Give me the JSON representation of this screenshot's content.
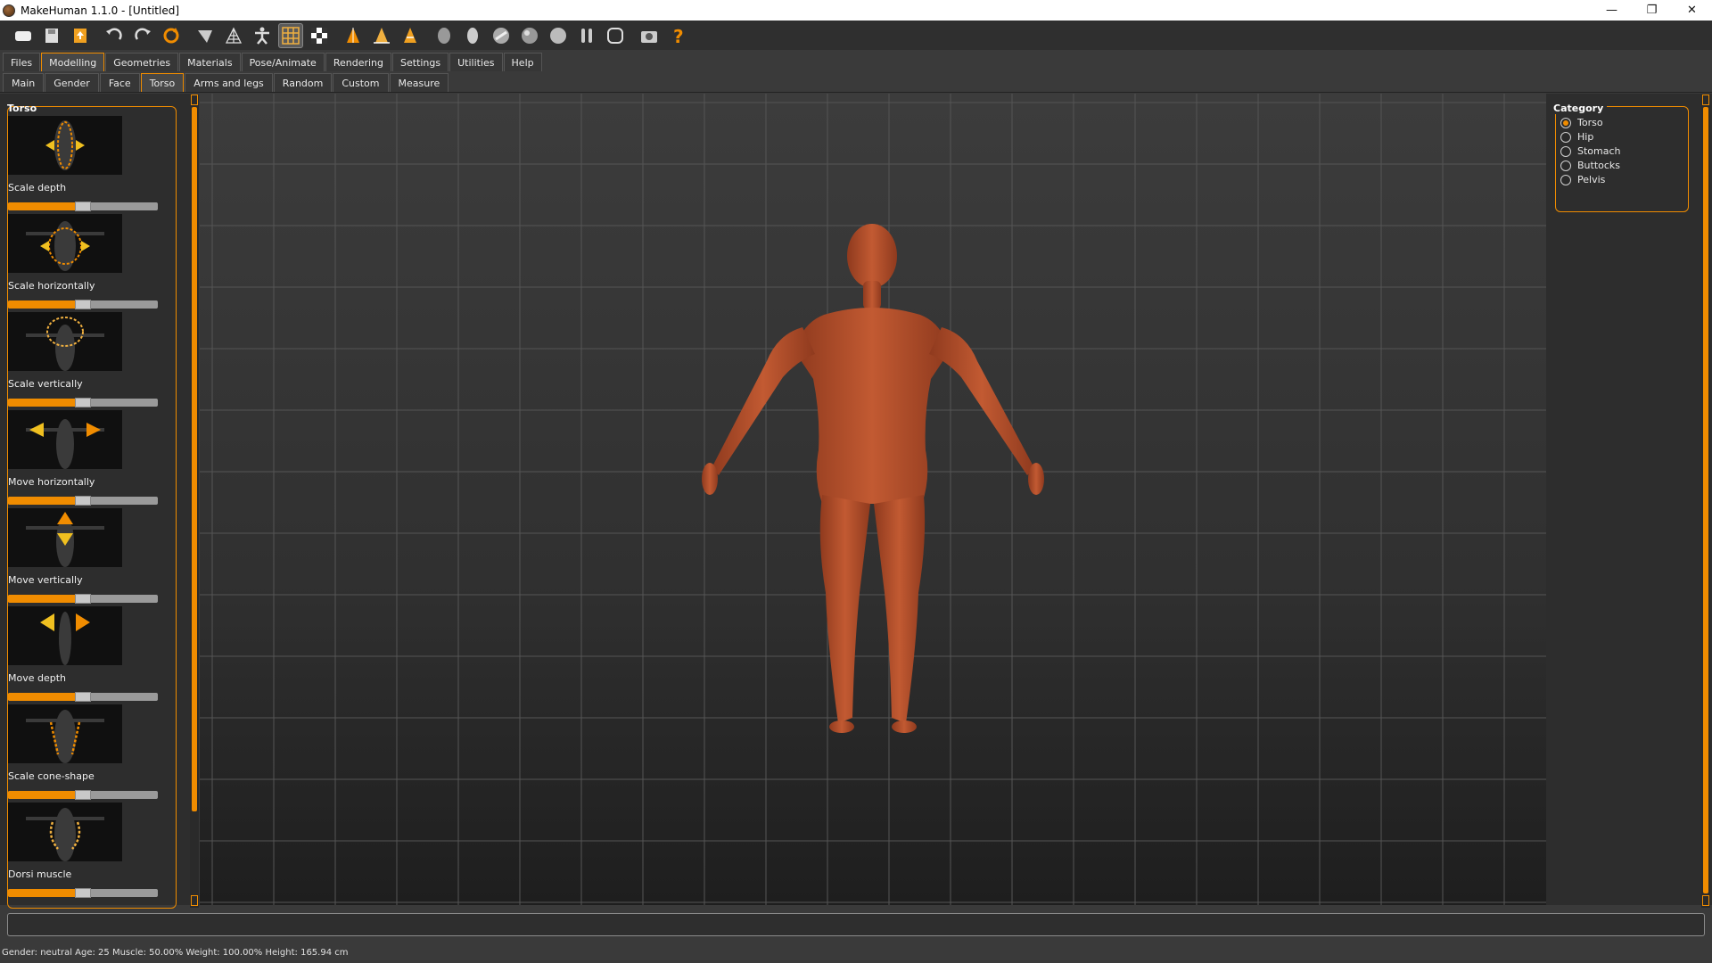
{
  "window": {
    "title": "MakeHuman 1.1.0 - [Untitled]",
    "minimize": "—",
    "restore": "❐",
    "close": "✕"
  },
  "toolbar": {
    "icons": [
      "file-icon",
      "save-icon",
      "export-icon",
      "undo-icon",
      "redo-icon",
      "reset-icon",
      "smooth-icon",
      "wireframe-icon",
      "pose-icon",
      "grid-icon",
      "checker-icon",
      "front-view-icon",
      "back-view-icon",
      "side-view-icon",
      "head-icon",
      "ellipse-icon",
      "shaded-icon",
      "sphere-icon",
      "solid-icon",
      "body-icon",
      "lasso-icon",
      "camera-icon",
      "help-icon"
    ]
  },
  "main_tabs": [
    "Files",
    "Modelling",
    "Geometries",
    "Materials",
    "Pose/Animate",
    "Rendering",
    "Settings",
    "Utilities",
    "Help"
  ],
  "main_active": "Modelling",
  "sub_tabs": [
    "Main",
    "Gender",
    "Face",
    "Torso",
    "Arms and legs",
    "Random",
    "Custom",
    "Measure"
  ],
  "sub_active": "Torso",
  "left_panel": {
    "title": "Torso",
    "sliders": [
      {
        "label": "Scale depth",
        "value": 0.5
      },
      {
        "label": "Scale horizontally",
        "value": 0.5
      },
      {
        "label": "Scale vertically",
        "value": 0.5
      },
      {
        "label": "Move horizontally",
        "value": 0.5
      },
      {
        "label": "Move vertically",
        "value": 0.5
      },
      {
        "label": "Move depth",
        "value": 0.5
      },
      {
        "label": "Scale cone-shape",
        "value": 0.5
      },
      {
        "label": "Dorsi muscle",
        "value": 0.5
      }
    ]
  },
  "right_panel": {
    "title": "Category",
    "options": [
      "Torso",
      "Hip",
      "Stomach",
      "Buttocks",
      "Pelvis"
    ],
    "selected": "Torso"
  },
  "statusbar": {
    "text": "Gender: neutral Age: 25 Muscle: 50.00% Weight: 100.00% Height: 165.94 cm"
  },
  "colors": {
    "accent": "#f08c00",
    "skin": "#b5502c",
    "bg": "#3a3a3a"
  }
}
